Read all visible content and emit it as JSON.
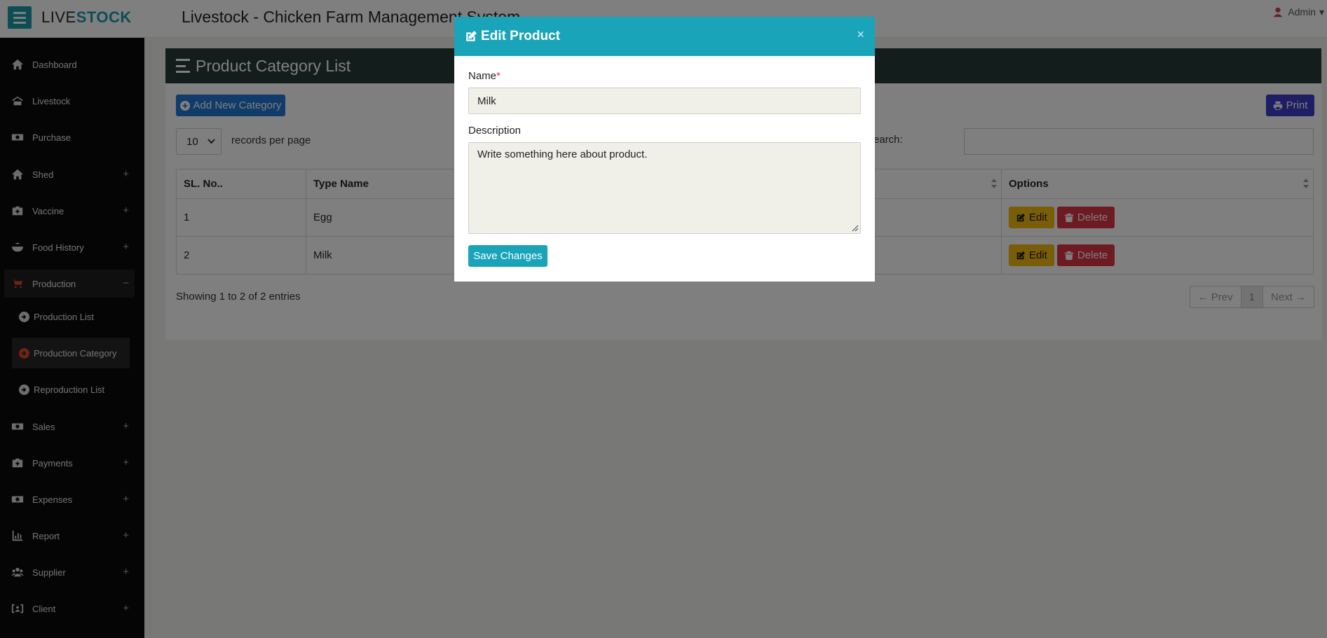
{
  "header": {
    "brand_part1": "LIVE",
    "brand_part2": "STOCK",
    "app_title": "Livestock - Chicken Farm Management System",
    "user_label": "Admin"
  },
  "sidebar": {
    "items": [
      {
        "label": "Dashboard",
        "icon": "home-icon"
      },
      {
        "label": "Livestock",
        "icon": "farm-icon"
      },
      {
        "label": "Purchase",
        "icon": "money-icon"
      },
      {
        "label": "Shed",
        "icon": "home-icon",
        "expand": "+"
      },
      {
        "label": "Vaccine",
        "icon": "medkit-icon",
        "expand": "+"
      },
      {
        "label": "Food History",
        "icon": "bowl-icon",
        "expand": "+"
      },
      {
        "label": "Production",
        "icon": "cart-icon",
        "expand": "−"
      },
      {
        "label": "Sales",
        "icon": "money-icon",
        "expand": "+"
      },
      {
        "label": "Payments",
        "icon": "medkit-icon",
        "expand": "+"
      },
      {
        "label": "Expenses",
        "icon": "money-icon",
        "expand": "+"
      },
      {
        "label": "Report",
        "icon": "chart-icon",
        "expand": "+"
      },
      {
        "label": "Supplier",
        "icon": "users-icon",
        "expand": "+"
      },
      {
        "label": "Client",
        "icon": "id-card-icon",
        "expand": "+"
      }
    ],
    "sub_items": [
      {
        "label": "Production List"
      },
      {
        "label": "Production Category"
      },
      {
        "label": "Reproduction List"
      }
    ]
  },
  "main": {
    "card_title": "Product Category List",
    "add_button": "Add New Category",
    "print_button": "Print",
    "page_length": "10",
    "length_label": "records per page",
    "search_label": "Search:",
    "table": {
      "headers": [
        "SL. No..",
        "Type Name",
        "",
        "Options"
      ],
      "rows": [
        {
          "sl": "1",
          "name": "Egg"
        },
        {
          "sl": "2",
          "name": "Milk"
        }
      ],
      "edit_label": "Edit",
      "delete_label": "Delete"
    },
    "showing": "Showing 1 to 2 of 2 entries",
    "pager": {
      "prev": "← Prev",
      "current": "1",
      "next": "Next →"
    }
  },
  "modal": {
    "title": "Edit Product",
    "close": "×",
    "name_label": "Name",
    "required_mark": "*",
    "name_value": "Milk",
    "desc_label": "Description",
    "desc_value": "Write something here about product.",
    "save_button": "Save Changes"
  },
  "colors": {
    "accent": "#1aa4ba",
    "header_dark": "#263b38",
    "sidebar_bg": "#0b0b0b",
    "add_btn": "#2176d4",
    "print_btn": "#3b3cc8",
    "edit_btn": "#f2bb10",
    "delete_btn": "#dc3545"
  }
}
